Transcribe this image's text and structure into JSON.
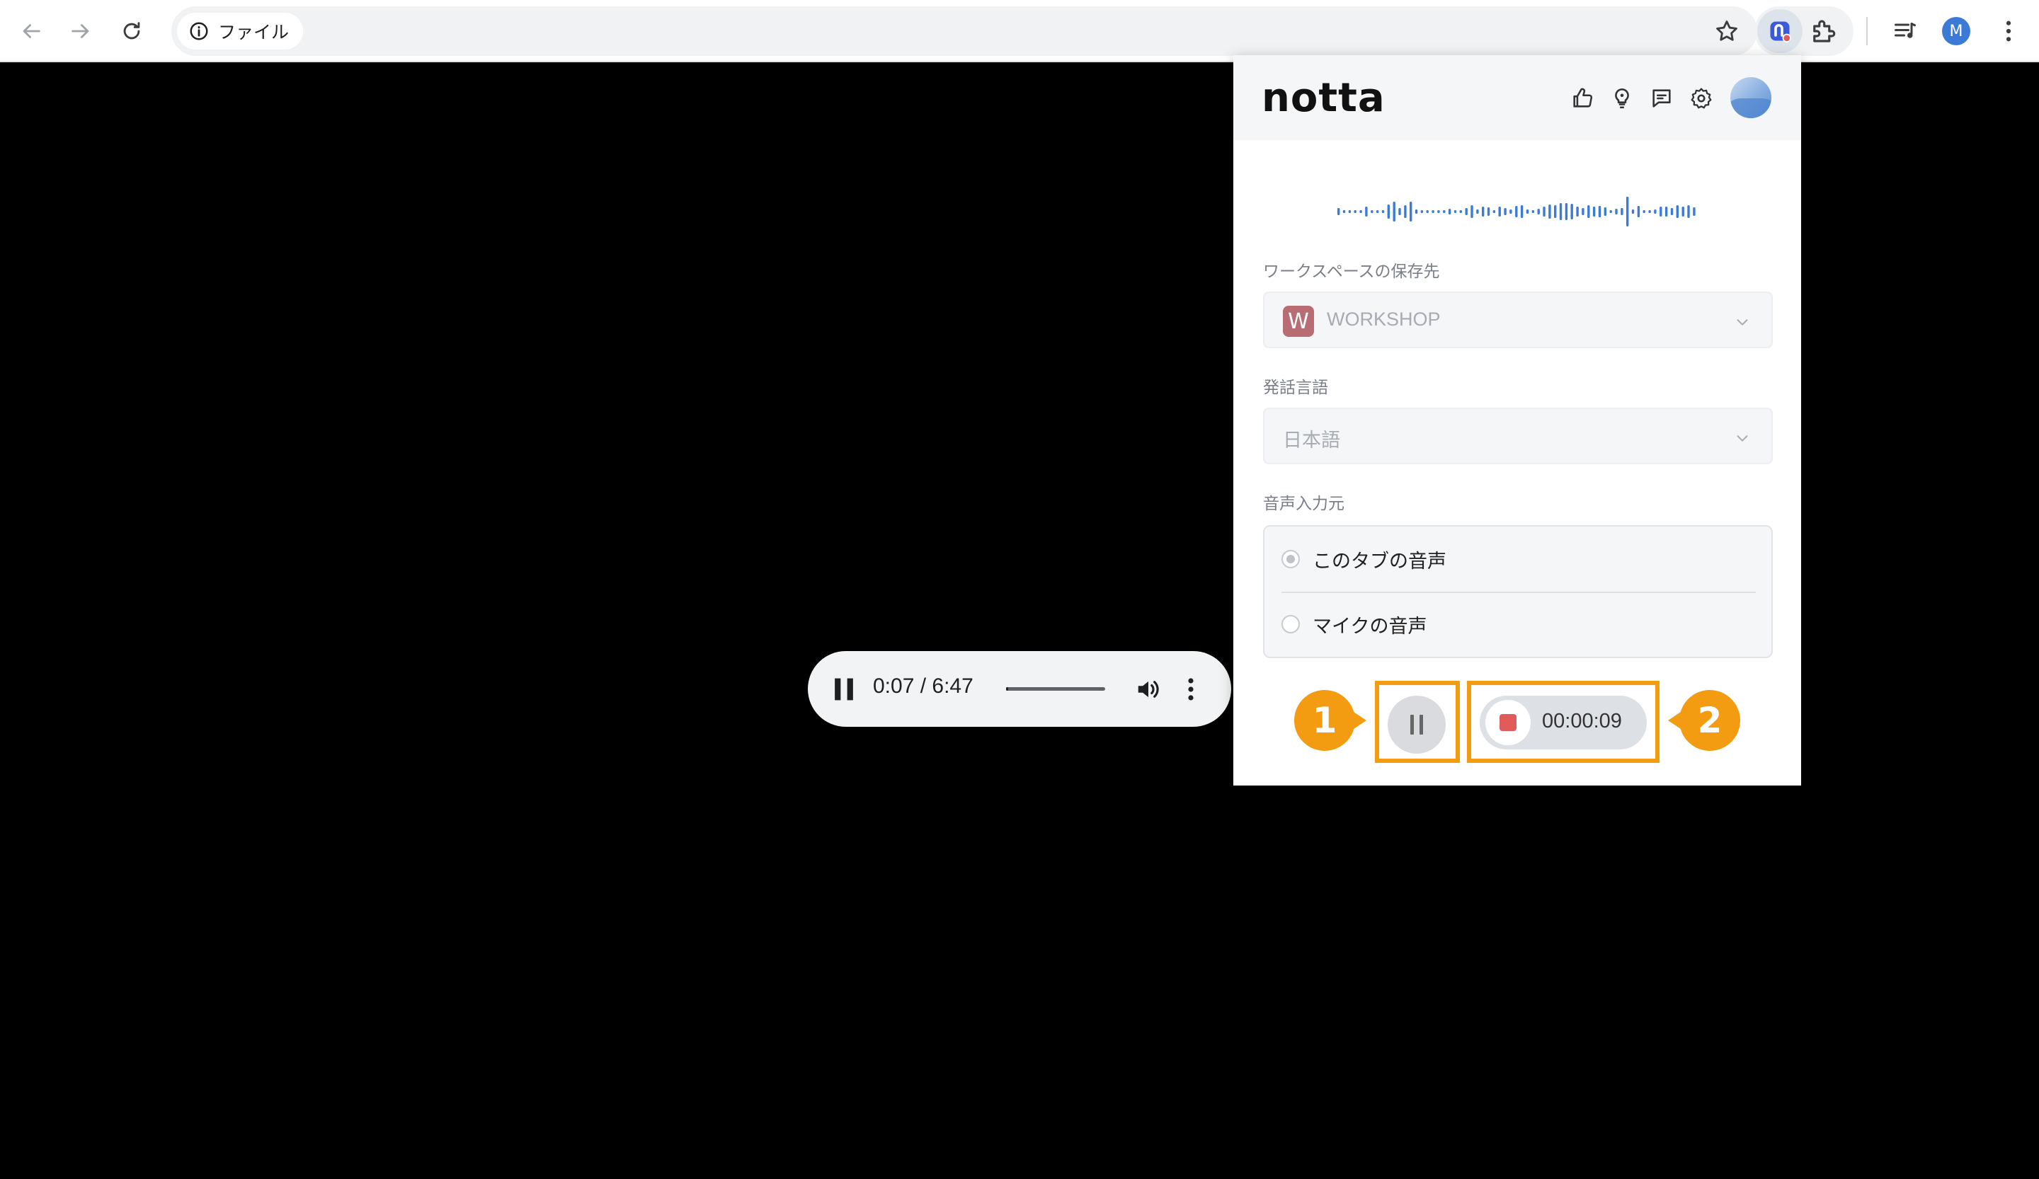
{
  "browser": {
    "site_chip_label": "ファイル",
    "profile_initial": "M"
  },
  "player": {
    "time": "0:07 / 6:47",
    "progress": 0.02
  },
  "popup": {
    "logo": "notta",
    "header_icons": [
      "thumbs-up-icon",
      "lightbulb-icon",
      "feedback-icon",
      "gear-icon"
    ],
    "workspace": {
      "label": "ワークスペースの保存先",
      "badge": "W",
      "value": "WORKSHOP"
    },
    "language": {
      "label": "発話言語",
      "value": "日本語"
    },
    "audio_source": {
      "label": "音声入力元",
      "options": [
        {
          "label": "このタブの音声",
          "selected": true
        },
        {
          "label": "マイクの音声",
          "selected": false
        }
      ]
    },
    "timer": "00:00:09"
  },
  "callouts": {
    "one": "1",
    "two": "2"
  },
  "colors": {
    "highlight": "#f39c12",
    "stop": "#e25b5b",
    "waveform": "#3b7bd6"
  }
}
